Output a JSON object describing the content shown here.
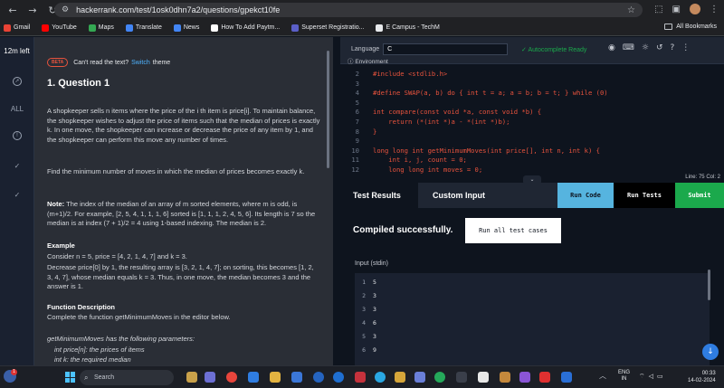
{
  "browser": {
    "url": "hackerrank.com/test/1osk0dhn7a2/questions/gpekct10fe",
    "all_bookmarks": "All Bookmarks",
    "bookmarks": [
      {
        "label": "Gmail",
        "color": "#ea4335"
      },
      {
        "label": "YouTube",
        "color": "#ff0000"
      },
      {
        "label": "Maps",
        "color": "#34a853"
      },
      {
        "label": "Translate",
        "color": "#4285f4"
      },
      {
        "label": "News",
        "color": "#4285f4"
      },
      {
        "label": "How To Add Paytm...",
        "color": "#ffffff"
      },
      {
        "label": "Superset Registratio...",
        "color": "#5b5fc7"
      },
      {
        "label": "E Campus - TechM",
        "color": "#e8eaed"
      }
    ]
  },
  "rail": {
    "timer": "12m left",
    "all_label": "ALL"
  },
  "problem": {
    "beta": "BETA",
    "cant_read": "Can't read the text?",
    "switch_link": "Switch",
    "theme": "theme",
    "title": "1. Question 1",
    "p1": "A shopkeeper sells n items where the price of the i th item is price[i]. To maintain balance, the shopkeeper wishes to adjust the price of items such that the median of prices is exactly k. In one move, the shopkeeper can increase or decrease the price of any item by 1, and the shopkeeper can perform this move any number of times.",
    "p2": "Find the minimum number of moves in which the median of prices becomes exactly k.",
    "note_label": "Note:",
    "note": "The index of the median of an array of m sorted elements, where m is odd, is (m+1)/2. For example, [2, 5, 4, 1, 1, 1, 6] sorted is [1, 1, 1, 2, 4, 5, 6]. Its length is 7 so the median is at index (7 + 1)/2 = 4 using 1-based indexing. The median is 2.",
    "example_heading": "Example",
    "example_line": "Consider n = 5, price = [4, 2, 1, 4, 7] and k = 3.",
    "example_text": "Decrease price[0] by 1, the resulting array is [3, 2, 1, 4, 7]; on sorting, this becomes [1, 2, 3, 4, 7], whose median equals k = 3. Thus, in one move, the median becomes 3 and the answer is 1.",
    "func_heading": "Function Description",
    "func_text": "Complete the function getMinimumMoves in the editor below.",
    "params_intro": "getMinimumMoves has the following parameters:",
    "param1": "int price[n]: the prices of items",
    "param2": "int k: the required median"
  },
  "editor": {
    "language_label": "Language",
    "language_value": "C",
    "environment": "Environment",
    "autocomplete": "Autocomplete Ready",
    "line_col": "Line: 75 Col: 2",
    "lines": [
      {
        "n": "2",
        "code": "#include <stdlib.h>"
      },
      {
        "n": "3",
        "code": ""
      },
      {
        "n": "4",
        "code": "#define SWAP(a, b) do { int t = a; a = b; b = t; } while (0)"
      },
      {
        "n": "5",
        "code": ""
      },
      {
        "n": "6",
        "code": "int compare(const void *a, const void *b) {"
      },
      {
        "n": "7",
        "code": "    return (*(int *)a - *(int *)b);"
      },
      {
        "n": "8",
        "code": "}"
      },
      {
        "n": "9",
        "code": ""
      },
      {
        "n": "10",
        "code": "long long int getMinimumMoves(int price[], int n, int k) {"
      },
      {
        "n": "11",
        "code": "    int i, j, count = 0;"
      },
      {
        "n": "12",
        "code": "    long long int moves = 0;"
      }
    ]
  },
  "bottom": {
    "tab_results": "Test Results",
    "tab_custom": "Custom Input",
    "run_code": "Run Code",
    "run_tests": "Run Tests",
    "submit": "Submit",
    "compiled": "Compiled successfully.",
    "run_all": "Run all test cases",
    "stdin_label": "Input (stdin)",
    "stdin": [
      {
        "n": "1",
        "v": "5"
      },
      {
        "n": "2",
        "v": "3"
      },
      {
        "n": "3",
        "v": "3"
      },
      {
        "n": "4",
        "v": "6"
      },
      {
        "n": "5",
        "v": "3"
      },
      {
        "n": "6",
        "v": "9"
      }
    ]
  },
  "taskbar": {
    "badge": "1",
    "search": "Search",
    "lang1": "ENG",
    "lang2": "IN",
    "time": "00:33",
    "date": "14-02-2024"
  }
}
